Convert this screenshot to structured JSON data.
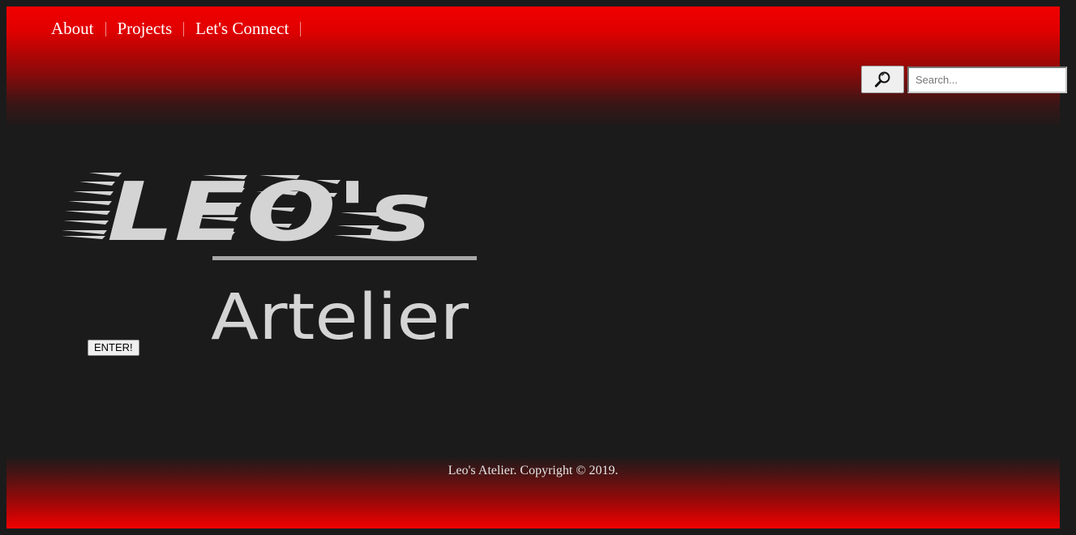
{
  "nav": {
    "items": [
      {
        "label": "About"
      },
      {
        "label": "Projects"
      },
      {
        "label": "Let's Connect"
      }
    ]
  },
  "search": {
    "placeholder": "Search...",
    "icon": "magnifier-icon"
  },
  "logo": {
    "line1": "LEO's",
    "line2": "Artelier"
  },
  "enter_button": {
    "label": "ENTER!"
  },
  "footer": {
    "text": "Leo's Atelier. Copyright © 2019."
  },
  "colors": {
    "brand_red": "#f20000",
    "background": "#1b1b1b",
    "logo_text": "#d4d4d4"
  }
}
